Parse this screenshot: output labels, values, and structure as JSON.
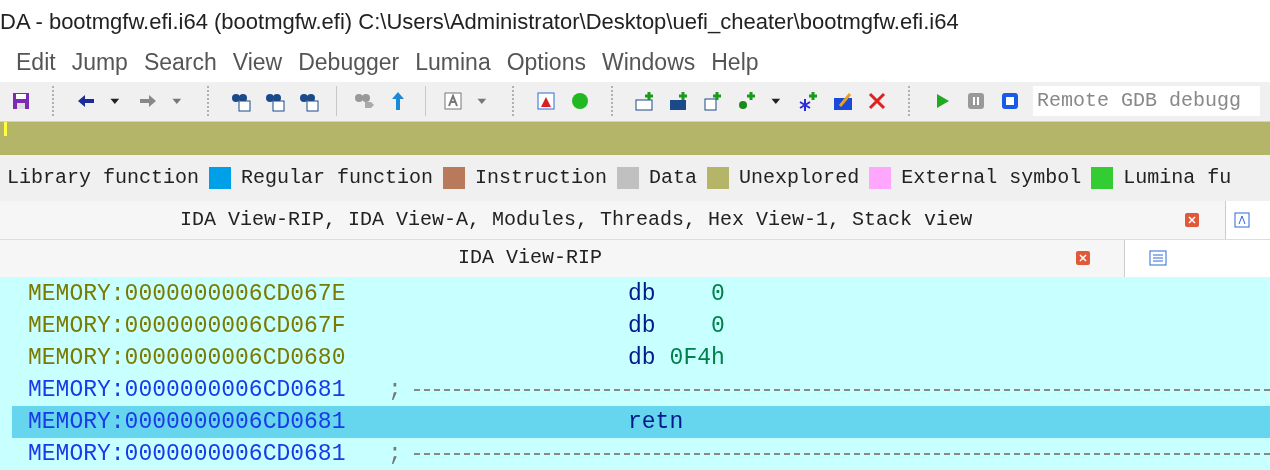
{
  "window": {
    "title": "DA - bootmgfw.efi.i64 (bootmgfw.efi) C:\\Users\\Administrator\\Desktop\\uefi_cheater\\bootmgfw.efi.i64"
  },
  "menu": [
    {
      "label": "Edit"
    },
    {
      "label": "Jump"
    },
    {
      "label": "Search"
    },
    {
      "label": "View"
    },
    {
      "label": "Debugger"
    },
    {
      "label": "Lumina"
    },
    {
      "label": "Options"
    },
    {
      "label": "Windows"
    },
    {
      "label": "Help"
    }
  ],
  "toolbar": {
    "debugger_select": {
      "value": "Remote GDB debugg"
    }
  },
  "legend": [
    {
      "label": "Library function"
    },
    {
      "label": "Regular function",
      "color": "#00a0e8"
    },
    {
      "label": "Instruction",
      "color": "#b87a5a"
    },
    {
      "label": "Data",
      "color": "#c0c0c0"
    },
    {
      "label": "Unexplored",
      "color": "#b5b56a"
    },
    {
      "label": "External symbol",
      "color": "#ffa6ff"
    },
    {
      "label": "Lumina fu",
      "color": "#33cc33"
    }
  ],
  "outer_tab": {
    "title": "IDA View-RIP, IDA View-A, Modules, Threads, Hex View-1, Stack view"
  },
  "inner_tab": {
    "title": "IDA View-RIP"
  },
  "listing": [
    {
      "kind": "data",
      "address": "MEMORY:0000000006CD067E",
      "mnemonic": "db",
      "operand": "   0",
      "selected": false
    },
    {
      "kind": "data",
      "address": "MEMORY:0000000006CD067F",
      "mnemonic": "db",
      "operand": "   0",
      "selected": false
    },
    {
      "kind": "data",
      "address": "MEMORY:0000000006CD0680",
      "mnemonic": "db",
      "operand": "0F4h",
      "selected": false
    },
    {
      "kind": "separator",
      "address": "MEMORY:0000000006CD0681",
      "comment": ";",
      "selected": false
    },
    {
      "kind": "code",
      "address": "MEMORY:0000000006CD0681",
      "mnemonic": "retn",
      "selected": true
    },
    {
      "kind": "separator",
      "address": "MEMORY:0000000006CD0681",
      "comment": ";",
      "selected": false
    }
  ]
}
